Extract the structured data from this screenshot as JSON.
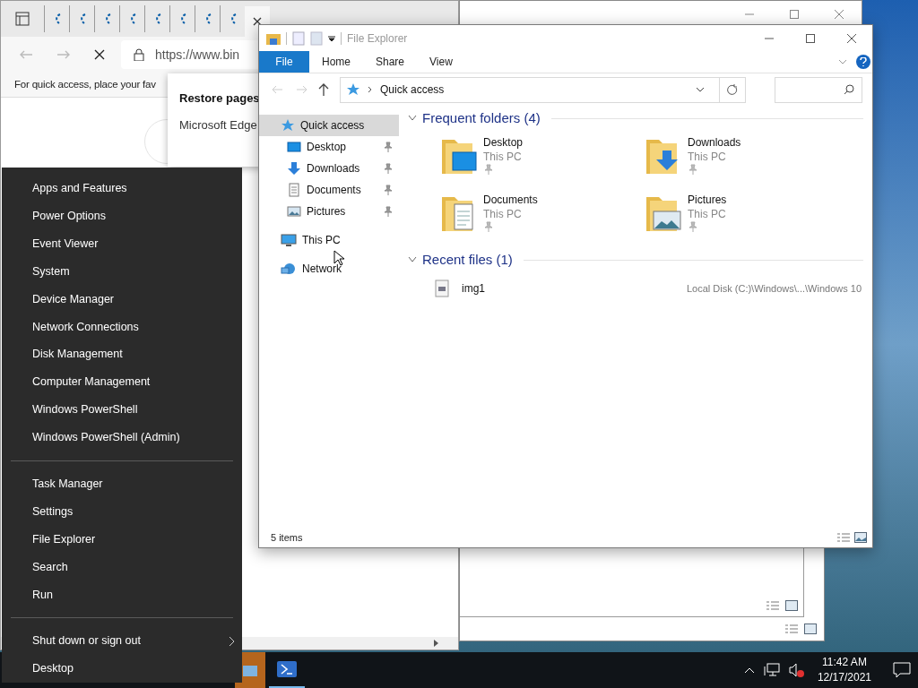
{
  "browser": {
    "url": "https://www.bin",
    "favorites_hint": "For quick access, place your fav",
    "restore_dialog": {
      "title": "Restore pages",
      "message": "Microsoft Edge"
    }
  },
  "explorer": {
    "title": "File Explorer",
    "ribbon_tabs": [
      {
        "label": "File",
        "selected": true
      },
      {
        "label": "Home",
        "selected": false
      },
      {
        "label": "Share",
        "selected": false
      },
      {
        "label": "View",
        "selected": false
      }
    ],
    "address": "Quick access",
    "nav": [
      {
        "label": "Quick access",
        "kind": "star",
        "selected": true,
        "children": [
          {
            "label": "Desktop",
            "kind": "desktop",
            "selected": false,
            "pinned": true
          },
          {
            "label": "Downloads",
            "kind": "downloads",
            "selected": false,
            "pinned": true
          },
          {
            "label": "Documents",
            "kind": "documents",
            "selected": false,
            "pinned": true
          },
          {
            "label": "Pictures",
            "kind": "pictures",
            "selected": false,
            "pinned": true
          }
        ]
      },
      {
        "label": "This PC",
        "kind": "pc",
        "selected": false
      },
      {
        "label": "Network",
        "kind": "network",
        "selected": false
      }
    ],
    "frequent_folders": {
      "title": "Frequent folders (4)",
      "expanded": true,
      "items": [
        {
          "name": "Desktop",
          "location": "This PC",
          "kind": "desktop",
          "pinned": true
        },
        {
          "name": "Downloads",
          "location": "This PC",
          "kind": "downloads",
          "pinned": true
        },
        {
          "name": "Documents",
          "location": "This PC",
          "kind": "documents",
          "pinned": true
        },
        {
          "name": "Pictures",
          "location": "This PC",
          "kind": "pictures",
          "pinned": true
        }
      ]
    },
    "recent_files": {
      "title": "Recent files (1)",
      "expanded": true,
      "items": [
        {
          "name": "img1",
          "path": "Local Disk (C:)\\Windows\\...\\Windows 10"
        }
      ]
    },
    "status_bar": "5 items"
  },
  "power_menu": {
    "sections": [
      [
        {
          "label": "Apps and Features",
          "submenu": false
        },
        {
          "label": "Power Options",
          "submenu": false
        },
        {
          "label": "Event Viewer",
          "submenu": false
        },
        {
          "label": "System",
          "submenu": false
        },
        {
          "label": "Device Manager",
          "submenu": false
        },
        {
          "label": "Network Connections",
          "submenu": false
        },
        {
          "label": "Disk Management",
          "submenu": false
        },
        {
          "label": "Computer Management",
          "submenu": false
        },
        {
          "label": "Windows PowerShell",
          "submenu": false
        },
        {
          "label": "Windows PowerShell (Admin)",
          "submenu": false
        }
      ],
      [
        {
          "label": "Task Manager",
          "submenu": false
        },
        {
          "label": "Settings",
          "submenu": false
        },
        {
          "label": "File Explorer",
          "submenu": false
        },
        {
          "label": "Search",
          "submenu": false
        },
        {
          "label": "Run",
          "submenu": false
        }
      ],
      [
        {
          "label": "Shut down or sign out",
          "submenu": true
        },
        {
          "label": "Desktop",
          "submenu": false
        }
      ]
    ]
  },
  "taskbar": {
    "time": "11:42 AM",
    "date": "12/17/2021"
  }
}
